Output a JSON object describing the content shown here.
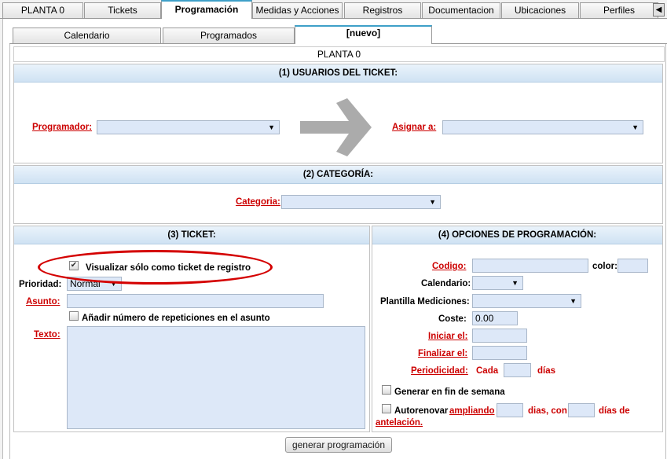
{
  "top_tabs": [
    {
      "label": "PLANTA 0"
    },
    {
      "label": "Tickets"
    },
    {
      "label": "Programación"
    },
    {
      "label": "Medidas y Acciones"
    },
    {
      "label": "Registros"
    },
    {
      "label": "Documentacion"
    },
    {
      "label": "Ubicaciones"
    },
    {
      "label": "Perfiles"
    }
  ],
  "sub_tabs": [
    {
      "label": "Calendario"
    },
    {
      "label": "Programados"
    },
    {
      "label": "[nuevo]"
    }
  ],
  "planta_title": "PLANTA 0",
  "section1": {
    "title": "(1) USUARIOS DEL TICKET:",
    "programador_label": "Programador:",
    "programador_value": "",
    "asignar_label": "Asignar a:",
    "asignar_value": ""
  },
  "section2": {
    "title": "(2) CATEGORÍA:",
    "categoria_label": "Categoria:",
    "categoria_value": ""
  },
  "section3": {
    "title": "(3) TICKET:",
    "visualizar_label": "Visualizar sólo como ticket de registro",
    "visualizar_checked": true,
    "prioridad_label": "Prioridad:",
    "prioridad_value": "Normal",
    "asunto_label": "Asunto:",
    "asunto_value": "",
    "anadir_label": "Añadir número de repeticiones en el asunto",
    "texto_label": "Texto:",
    "texto_value": ""
  },
  "section4": {
    "title": "(4) OPCIONES DE PROGRAMACIÓN:",
    "codigo_label": "Codigo:",
    "codigo_value": "",
    "color_label": "color:",
    "color_value": "",
    "calendario_label": "Calendario:",
    "plantilla_label": "Plantilla Mediciones:",
    "coste_label": "Coste:",
    "coste_value": "0.00",
    "iniciar_label": "Iniciar el:",
    "finalizar_label": "Finalizar el:",
    "periodicidad_label": "Periodicidad:",
    "cada_label": "Cada",
    "dias_label": "días",
    "generar_finde_label": "Generar en fin de semana",
    "autorenovar_label": "Autorenovar",
    "ampliando_label": "ampliando",
    "dias_con_label": "dias, con",
    "dias_de_label": "días de",
    "antelacion_label": "antelación."
  },
  "generate_button": "generar programación",
  "colors": {
    "accent": "#3ea0c8",
    "required": "#cc0000",
    "field_bg": "#dde8f8",
    "annotation": "#d40000"
  }
}
